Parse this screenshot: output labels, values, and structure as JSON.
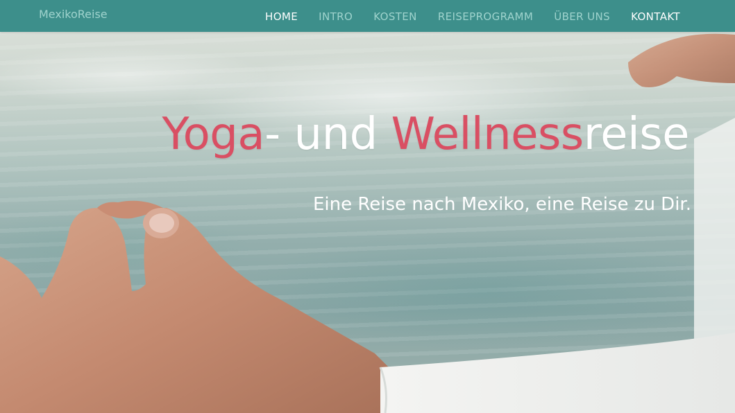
{
  "navbar": {
    "brand": "MexikoReise",
    "items": [
      {
        "label": "HOME"
      },
      {
        "label": "INTRO"
      },
      {
        "label": "KOSTEN"
      },
      {
        "label": "REISEPROGRAMM"
      },
      {
        "label": "ÜBER UNS"
      },
      {
        "label": "KONTAKT"
      }
    ]
  },
  "hero": {
    "title_parts": {
      "yoga": "Yoga",
      "dash_und": "- und ",
      "wellness": "Wellness",
      "reise": "reise"
    },
    "subtitle": "Eine Reise nach Mexiko, eine Reise zu Dir."
  },
  "colors": {
    "navbar_bg": "#3d8f8b",
    "nav_inactive": "#9fd3cd",
    "nav_active": "#ffffff",
    "title_accent": "#d94f63",
    "title_main": "#ffffff"
  }
}
